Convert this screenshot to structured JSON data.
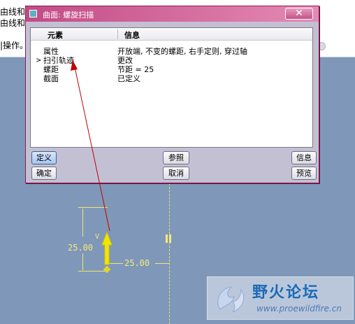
{
  "background_app": {
    "line1": "由线和",
    "line2": "由线和",
    "line3": "|操作。"
  },
  "dialog": {
    "title": "曲面: 螺旋扫描",
    "close_label": "✕",
    "columns": {
      "element": "元素",
      "info": "信息"
    },
    "rows": [
      {
        "marker": "",
        "element": "属性",
        "info": "开放端, 不变的螺距, 右手定则, 穿过轴"
      },
      {
        "marker": ">",
        "element": "扫引轨迹",
        "info": "更改"
      },
      {
        "marker": "",
        "element": "螺距",
        "info": "节距 = 25"
      },
      {
        "marker": "",
        "element": "截面",
        "info": "已定义"
      }
    ],
    "buttons": {
      "define": "定义",
      "reference": "参照",
      "info": "信息",
      "ok": "确定",
      "cancel": "取消",
      "preview": "预览"
    }
  },
  "graphics": {
    "dim_vertical": "25.00",
    "dim_horizontal": "25.00",
    "axis_label": "V",
    "colors": {
      "dimension": "#f4ea78",
      "axis": "#f2e600",
      "annotation_arrow": "#c00000"
    }
  },
  "watermark": {
    "title": "野火论坛",
    "url": "www.proewildfire.cn"
  }
}
